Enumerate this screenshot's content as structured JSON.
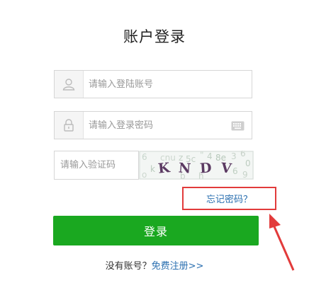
{
  "page": {
    "title": "账户登录"
  },
  "username": {
    "placeholder": "请输入登陆账号",
    "icon": "user-icon"
  },
  "password": {
    "placeholder": "请输入登录密码",
    "icon": "lock-icon",
    "keyboard_icon": "keyboard-icon"
  },
  "captcha": {
    "placeholder": "请输入验证码",
    "code": "KNDV"
  },
  "forgot": {
    "label": "忘记密码？"
  },
  "login": {
    "label": "登录"
  },
  "register": {
    "prefix": "没有账号？",
    "link": "免费注册>>"
  },
  "colors": {
    "primary": "#1aa820",
    "link": "#2a6fb0",
    "highlight": "#e23b3b"
  }
}
